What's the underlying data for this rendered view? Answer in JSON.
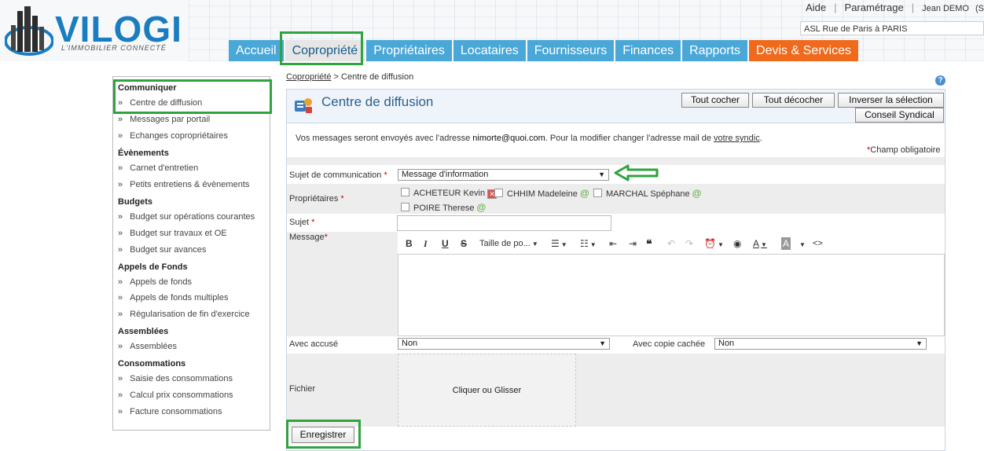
{
  "header": {
    "logo_text": "VILOGI",
    "logo_subtitle": "L'IMMOBILIER CONNECTÉ",
    "top_links": {
      "aide": "Aide",
      "parametrage": "Paramétrage",
      "user": "Jean DEMO",
      "extra": "(S"
    },
    "site_select_value": "ASL Rue de Paris à PARIS",
    "nav": [
      {
        "label": "Accueil"
      },
      {
        "label": "Copropriété"
      },
      {
        "label": "Propriétaires"
      },
      {
        "label": "Locataires"
      },
      {
        "label": "Fournisseurs"
      },
      {
        "label": "Finances"
      },
      {
        "label": "Rapports"
      },
      {
        "label": "Devis & Services"
      }
    ]
  },
  "sidebar": {
    "sections": [
      {
        "title": "Communiquer",
        "items": [
          "Centre de diffusion",
          "Messages par portail",
          "Echanges copropriétaires"
        ]
      },
      {
        "title": "Évènements",
        "items": [
          "Carnet d'entretien",
          "Petits entretiens & évènements"
        ]
      },
      {
        "title": "Budgets",
        "items": [
          "Budget sur opérations courantes",
          "Budget sur travaux et OE",
          "Budget sur avances"
        ]
      },
      {
        "title": "Appels de Fonds",
        "items": [
          "Appels de fonds",
          "Appels de fonds multiples",
          "Régularisation de fin d'exercice"
        ]
      },
      {
        "title": "Assemblées",
        "items": [
          "Assemblées"
        ]
      },
      {
        "title": "Consommations",
        "items": [
          "Saisie des consommations",
          "Calcul prix consommations",
          "Facture consommations"
        ]
      }
    ],
    "bullet": "»"
  },
  "breadcrumb": {
    "parent": "Copropriété",
    "separator": ">",
    "current": "Centre de diffusion"
  },
  "panel": {
    "title": "Centre de diffusion",
    "buttons": {
      "check_all": "Tout cocher",
      "uncheck_all": "Tout décocher",
      "invert": "Inverser la sélection",
      "council": "Conseil Syndical"
    },
    "info_prefix": "Vos messages seront envoyés avec l'adresse ",
    "info_email": "nimorte@quoi.com",
    "info_middle": ". Pour la modifier changer l'adresse mail de ",
    "info_link": "votre syndic",
    "info_suffix": ".",
    "required_note": "Champ obligatoire",
    "required_star": "*"
  },
  "form": {
    "subject_type_label": "Sujet de communication",
    "subject_type_value": "Message d'information",
    "owners_label": "Propriétaires",
    "owners": [
      "ACHETEUR Kevin",
      "CHHIM Madeleine",
      "MARCHAL Spéphane",
      "POIRE Therese"
    ],
    "subject_label": "Sujet",
    "subject_value": "",
    "message_label": "Message",
    "toolbar": {
      "bold": "B",
      "italic": "I",
      "underline": "U",
      "strike": "S",
      "font_size": "Taille de po...",
      "quote": "❝",
      "code": "<>"
    },
    "ack_label": "Avec accusé",
    "ack_value": "Non",
    "bcc_label": "Avec copie cachée",
    "bcc_value": "Non",
    "file_label": "Fichier",
    "dropzone_text": "Cliquer ou Glisser",
    "save_label": "Enregistrer"
  },
  "colors": {
    "nav_blue": "#4aa8d8",
    "nav_orange": "#ef6a1c",
    "highlight_green": "#2fa33d",
    "logo_blue": "#1a7dc1"
  }
}
